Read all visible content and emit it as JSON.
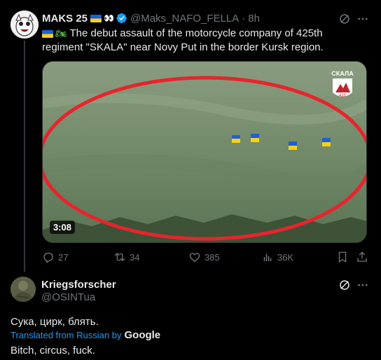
{
  "tweet": {
    "author_name": "MAKS 25",
    "author_handle": "@Maks_NAFO_FELLA",
    "dot": "·",
    "time": "8h",
    "text": "The debut assault of the motorcycle company of 425th regiment \"SKALA\" near Novy Put in the border Kursk region.",
    "media": {
      "duration": "3:08",
      "logo_text": "СКАЛА",
      "logo_sub": "425"
    },
    "actions": {
      "replies": "27",
      "reposts": "34",
      "likes": "385",
      "views": "36K"
    }
  },
  "reply": {
    "author_name": "Kriegsforscher",
    "author_handle": "@OSINTua",
    "text": "Сука, цирк, блять.",
    "translated_label": "Translated from Russian by",
    "translator": "Google",
    "translation": "Bitch, circus, fuck."
  },
  "colors": {
    "background": "#000000",
    "text": "#e7e9ea",
    "muted": "#71767b",
    "accent": "#1d9bf0",
    "circle": "#e8242c"
  },
  "icons": {
    "grok": "grok-icon",
    "more": "more-icon",
    "reply": "reply-icon",
    "repost": "repost-icon",
    "like": "heart-icon",
    "views": "views-icon",
    "bookmark": "bookmark-icon",
    "share": "share-icon"
  }
}
